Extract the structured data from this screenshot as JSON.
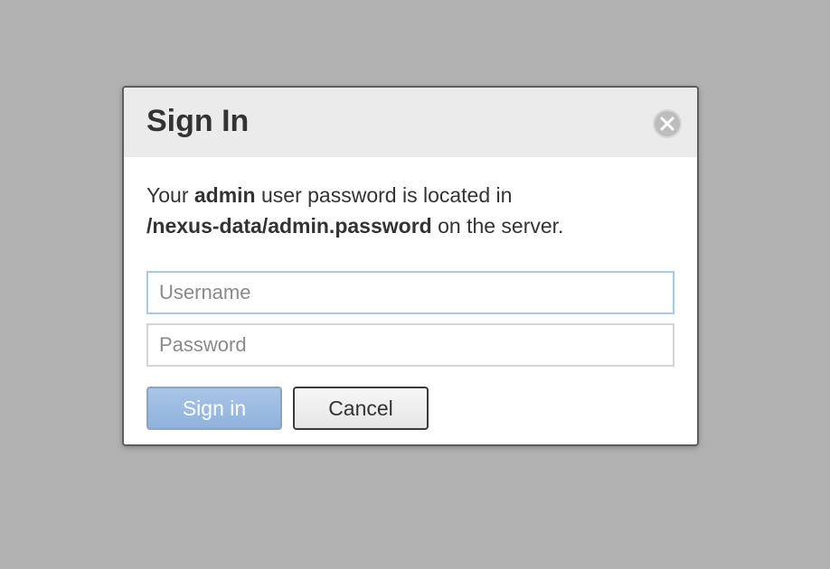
{
  "dialog": {
    "title": "Sign In",
    "message": {
      "part1": "Your ",
      "bold1": "admin",
      "part2": " user password is located in ",
      "bold2": "/nexus-data/admin.password",
      "part3": " on the server."
    },
    "username": {
      "placeholder": "Username",
      "value": ""
    },
    "password": {
      "placeholder": "Password",
      "value": ""
    },
    "signin_label": "Sign in",
    "cancel_label": "Cancel",
    "close_icon": "close-circle-icon"
  },
  "colors": {
    "backdrop": "#b1b1b1",
    "header": "#ebebeb",
    "primary_button": "#9dbde3",
    "focus_border": "#a9cbea"
  }
}
